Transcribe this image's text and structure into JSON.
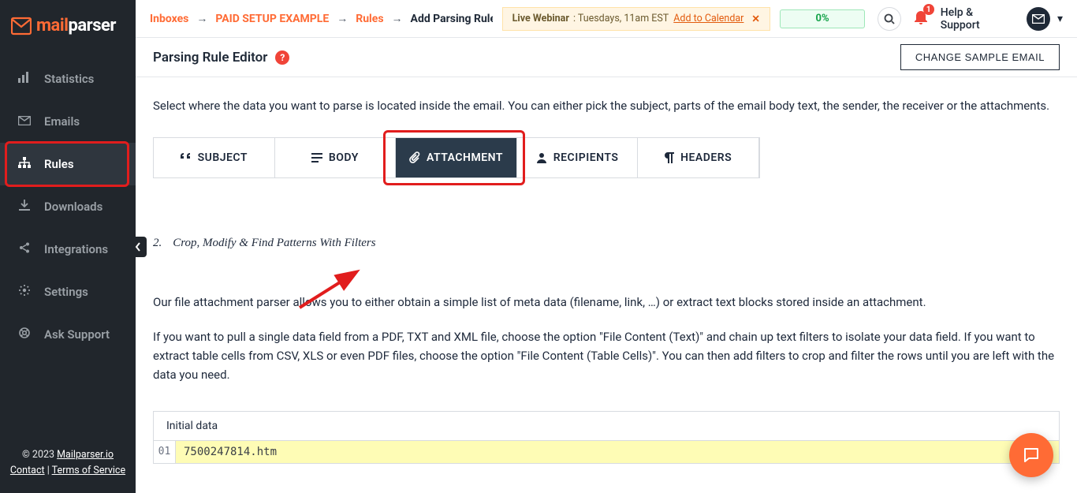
{
  "brand": {
    "mail": "mail",
    "parser": "parser"
  },
  "sidebar": {
    "items": [
      {
        "id": "statistics",
        "label": "Statistics",
        "icon": "chart"
      },
      {
        "id": "emails",
        "label": "Emails",
        "icon": "envelope"
      },
      {
        "id": "rules",
        "label": "Rules",
        "icon": "sitemap",
        "active": true,
        "highlight": true
      },
      {
        "id": "downloads",
        "label": "Downloads",
        "icon": "download"
      },
      {
        "id": "integrations",
        "label": "Integrations",
        "icon": "share"
      },
      {
        "id": "settings",
        "label": "Settings",
        "icon": "gear"
      },
      {
        "id": "asksupport",
        "label": "Ask Support",
        "icon": "lifebuoy"
      }
    ],
    "footer": {
      "copyright_prefix": "© 2023 ",
      "copyright_link": "Mailparser.io",
      "contact_label": "Contact",
      "separator": " | ",
      "tos_label": "Terms of Service"
    }
  },
  "breadcrumbs": {
    "items": [
      {
        "label": "Inboxes",
        "link": true
      },
      {
        "label": "PAID SETUP EXAMPLE",
        "link": true
      },
      {
        "label": "Rules",
        "link": true
      },
      {
        "label": "Add Parsing Rule",
        "current": true
      }
    ]
  },
  "webinar": {
    "bold": "Live Webinar",
    "text": ": Tuesdays, 11am EST",
    "cta": "Add to Calendar"
  },
  "top": {
    "pct": "0%",
    "help_label": "Help & Support",
    "notif_count": "1"
  },
  "page": {
    "title": "Parsing Rule Editor",
    "change_sample_btn": "CHANGE SAMPLE EMAIL",
    "intro": "Select where the data you want to parse is located inside the email. You can either pick the subject, parts of the email body text, the sender, the receiver or the attachments.",
    "tabs": [
      {
        "id": "subject",
        "label": "SUBJECT",
        "icon": "quote"
      },
      {
        "id": "body",
        "label": "BODY",
        "icon": "text"
      },
      {
        "id": "attachment",
        "label": "ATTACHMENT",
        "icon": "paperclip",
        "active": true,
        "highlight": true
      },
      {
        "id": "recipients",
        "label": "RECIPIENTS",
        "icon": "user"
      },
      {
        "id": "headers",
        "label": "HEADERS",
        "icon": "pilcrow"
      }
    ],
    "step2_num": "2.",
    "step2_text": "Crop, Modify & Find Patterns With Filters",
    "para1": "Our file attachment parser allows you to either obtain a simple list of meta data (filename, link, …) or extract text blocks stored inside an attachment.",
    "para2": "If you want to pull a single data field from a PDF, TXT and XML file, choose the option \"File Content (Text)\" and chain up text filters to isolate your data field. If you want to extract table cells from CSV, XLS or even PDF files, choose the option \"File Content (Table Cells)\". You can then add filters to crop and filter the rows until you are left with the data you need.",
    "initial_data_label": "Initial data",
    "initial_line_no": "01",
    "initial_value": "7500247814.htm"
  }
}
